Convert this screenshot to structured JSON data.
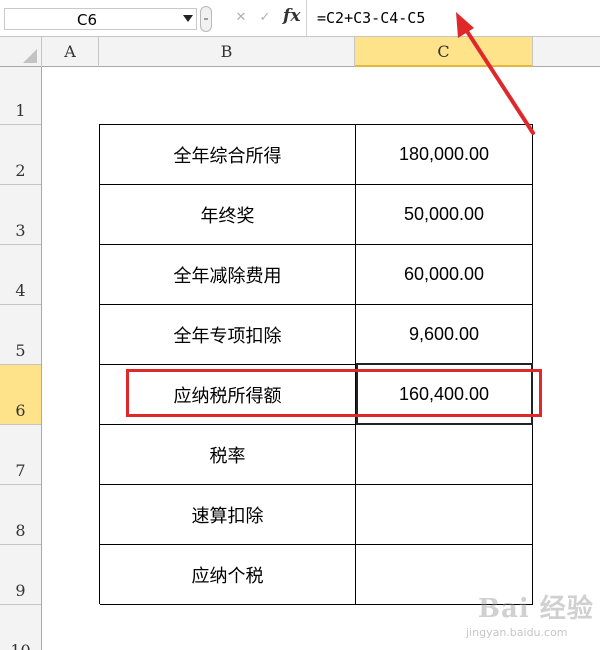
{
  "formula_bar": {
    "name_box": "C6",
    "cancel_icon": "✕",
    "enter_icon": "✓",
    "fx_label": "fx",
    "formula": "=C2+C3-C4-C5"
  },
  "columns": [
    "A",
    "B",
    "C"
  ],
  "rows": [
    "1",
    "2",
    "3",
    "4",
    "5",
    "6",
    "7",
    "8",
    "9",
    "10"
  ],
  "table": [
    {
      "label": "全年综合所得",
      "value": "180,000.00"
    },
    {
      "label": "年终奖",
      "value": "50,000.00"
    },
    {
      "label": "全年减除费用",
      "value": "60,000.00"
    },
    {
      "label": "全年专项扣除",
      "value": "9,600.00"
    },
    {
      "label": "应纳税所得额",
      "value": "160,400.00"
    },
    {
      "label": "税率",
      "value": ""
    },
    {
      "label": "速算扣除",
      "value": ""
    },
    {
      "label": "应纳个税",
      "value": ""
    }
  ],
  "active_cell": "C6",
  "watermark": {
    "logo": "Bai 经验",
    "url": "jingyan.baidu.com"
  },
  "colors": {
    "annotation": "#e0282a",
    "header_highlight": "#ffe38a"
  },
  "icons": {
    "name_box_dropdown": "chevron-down-icon",
    "function": "fx-icon",
    "arrow": "annotation-arrow-icon"
  }
}
